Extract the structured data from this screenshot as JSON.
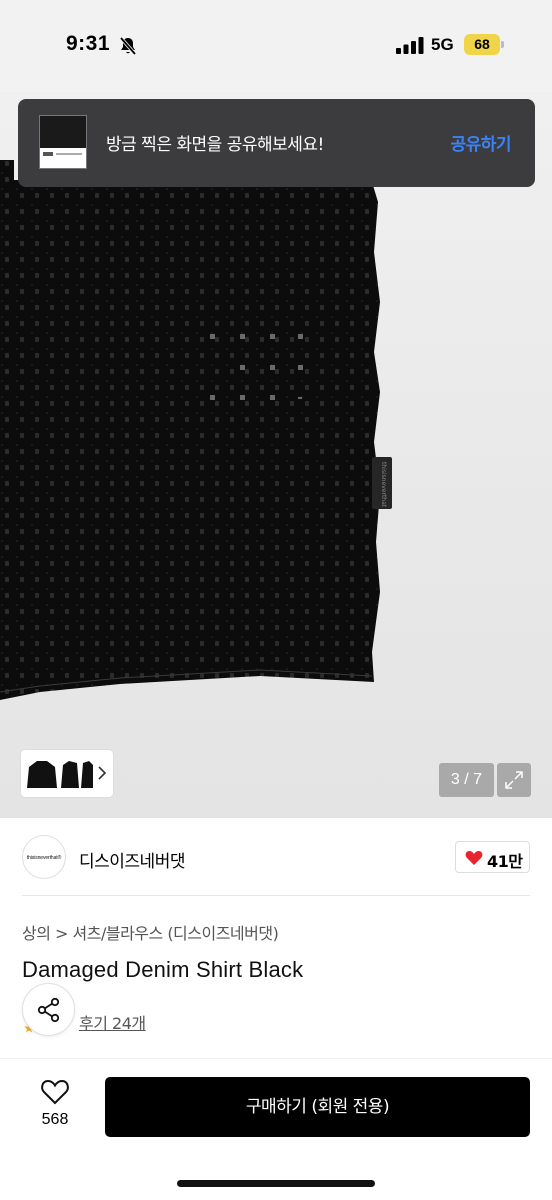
{
  "status_bar": {
    "time": "9:31",
    "network": "5G",
    "battery": "68",
    "icons": [
      "bell-off-icon",
      "signal-icon"
    ]
  },
  "share_toast": {
    "message": "방금 찍은 화면을 공유해보세요!",
    "action_label": "공유하기",
    "action_color": "#3a82f7"
  },
  "gallery": {
    "counter": "3 / 7",
    "garment_tag_text": "thisisneverthat",
    "icons": [
      "chevron-right-icon",
      "expand-icon"
    ]
  },
  "brand": {
    "logo_text": "thisisneverthat®",
    "name": "디스이즈네버댓",
    "likes": "41만",
    "heart_color": "#e8242f"
  },
  "product": {
    "breadcrumb": "상의 > 셔츠/블라우스 (디스이즈네버댓)",
    "title": "Damaged Denim Shirt Black",
    "reviews": "후기 24개"
  },
  "bottom_bar": {
    "wish_count": "568",
    "buy_label": "구매하기 (회원 전용)"
  }
}
